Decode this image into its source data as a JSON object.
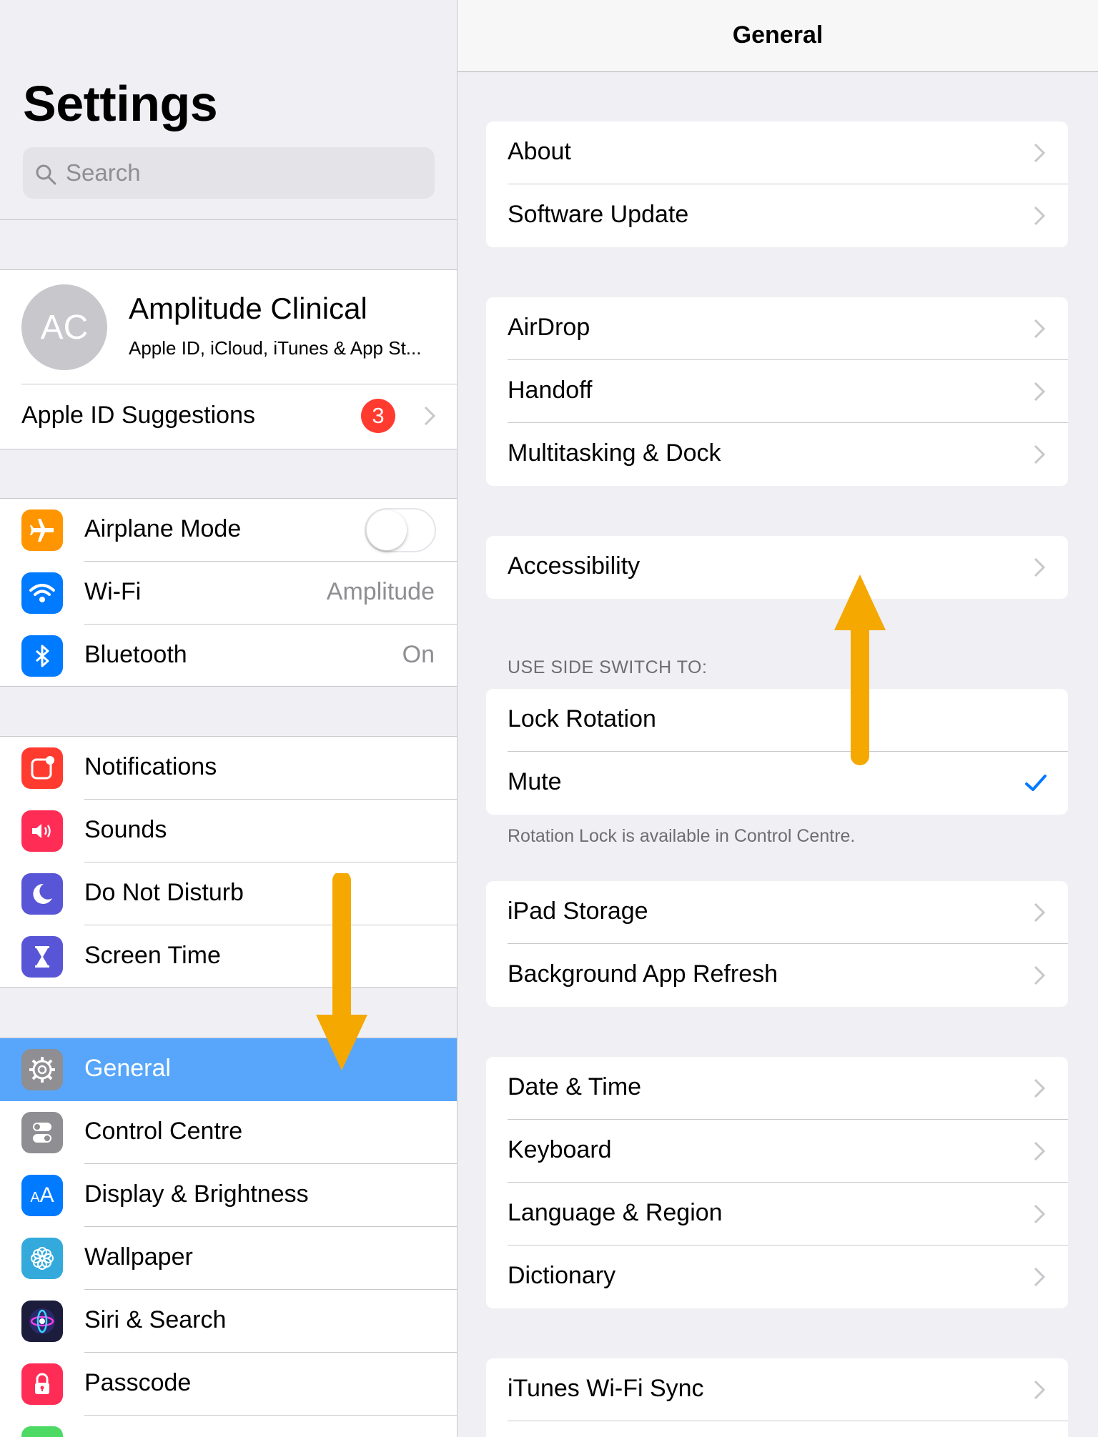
{
  "master": {
    "title": "Settings",
    "search_placeholder": "Search",
    "profile": {
      "initials": "AC",
      "name": "Amplitude Clinical",
      "subtitle": "Apple ID, iCloud, iTunes & App St..."
    },
    "suggestions": {
      "label": "Apple ID Suggestions",
      "badge": "3"
    },
    "connectivity": [
      {
        "label": "Airplane Mode",
        "icon": "airplane-icon",
        "color": "#ff9500",
        "toggle_on": false
      },
      {
        "label": "Wi-Fi",
        "value": "Amplitude",
        "icon": "wifi-icon",
        "color": "#007aff"
      },
      {
        "label": "Bluetooth",
        "value": "On",
        "icon": "bluetooth-icon",
        "color": "#007aff"
      }
    ],
    "alerts": [
      {
        "label": "Notifications",
        "icon": "notifications-icon",
        "color": "#ff3b30"
      },
      {
        "label": "Sounds",
        "icon": "speaker-icon",
        "color": "#ff2d55"
      },
      {
        "label": "Do Not Disturb",
        "icon": "moon-icon",
        "color": "#5856d6"
      },
      {
        "label": "Screen Time",
        "icon": "hourglass-icon",
        "color": "#5856d6"
      }
    ],
    "system": [
      {
        "label": "General",
        "icon": "gear-icon",
        "color": "#8e8e93",
        "selected": true
      },
      {
        "label": "Control Centre",
        "icon": "switches-icon",
        "color": "#8e8e93"
      },
      {
        "label": "Display & Brightness",
        "icon": "text-size-icon",
        "color": "#007aff"
      },
      {
        "label": "Wallpaper",
        "icon": "flower-icon",
        "color": "#34aadc"
      },
      {
        "label": "Siri & Search",
        "icon": "siri-icon",
        "color": "#1c1c3c"
      },
      {
        "label": "Passcode",
        "icon": "lock-icon",
        "color": "#ff2d55"
      }
    ]
  },
  "detail": {
    "title": "General",
    "group1": [
      "About",
      "Software Update"
    ],
    "group2": [
      "AirDrop",
      "Handoff",
      "Multitasking & Dock"
    ],
    "group3": [
      "Accessibility"
    ],
    "side_switch": {
      "header": "USE SIDE SWITCH TO:",
      "options": [
        "Lock Rotation",
        "Mute"
      ],
      "selected": "Mute",
      "footer": "Rotation Lock is available in Control Centre."
    },
    "group5": [
      "iPad Storage",
      "Background App Refresh"
    ],
    "group6": [
      "Date & Time",
      "Keyboard",
      "Language & Region",
      "Dictionary"
    ],
    "group7": [
      "iTunes Wi-Fi Sync"
    ]
  },
  "colors": {
    "accent": "#007aff",
    "selection": "#57a6fb",
    "arrow": "#f5a800",
    "badge": "#ff3b30"
  }
}
